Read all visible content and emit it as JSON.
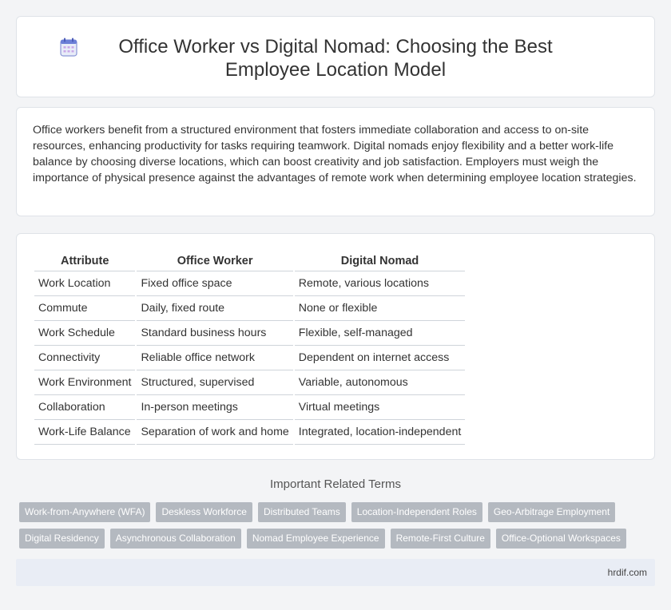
{
  "header": {
    "icon": "calendar-icon",
    "title": "Office Worker vs Digital Nomad: Choosing the Best Employee Location Model"
  },
  "summary": "Office workers benefit from a structured environment that fosters immediate collaboration and access to on-site resources, enhancing productivity for tasks requiring teamwork. Digital nomads enjoy flexibility and a better work-life balance by choosing diverse locations, which can boost creativity and job satisfaction. Employers must weigh the importance of physical presence against the advantages of remote work when determining employee location strategies.",
  "table": {
    "headers": [
      "Attribute",
      "Office Worker",
      "Digital Nomad"
    ],
    "rows": [
      [
        "Work Location",
        "Fixed office space",
        "Remote, various locations"
      ],
      [
        "Commute",
        "Daily, fixed route",
        "None or flexible"
      ],
      [
        "Work Schedule",
        "Standard business hours",
        "Flexible, self-managed"
      ],
      [
        "Connectivity",
        "Reliable office network",
        "Dependent on internet access"
      ],
      [
        "Work Environment",
        "Structured, supervised",
        "Variable, autonomous"
      ],
      [
        "Collaboration",
        "In-person meetings",
        "Virtual meetings"
      ],
      [
        "Work-Life Balance",
        "Separation of work and home",
        "Integrated, location-independent"
      ]
    ]
  },
  "related": {
    "title": "Important Related Terms",
    "row1": [
      "Work-from-Anywhere (WFA)",
      "Deskless Workforce",
      "Distributed Teams",
      "Location-Independent Roles",
      "Geo-Arbitrage Employment"
    ],
    "row2": [
      "Digital Residency",
      "Asynchronous Collaboration",
      "Nomad Employee Experience",
      "Remote-First Culture",
      "Office-Optional Workspaces"
    ]
  },
  "footer": {
    "site": "hrdif.com"
  },
  "colors": {
    "tag_bg": "#b4b9c0",
    "footer_bg": "#e9edf5",
    "icon_accent": "#6b7fd7"
  }
}
